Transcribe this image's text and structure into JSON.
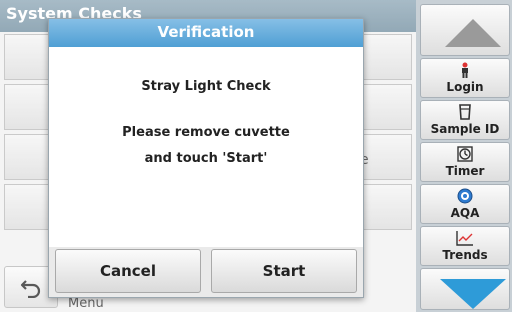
{
  "background": {
    "title": "System Checks",
    "right_fragment": "e",
    "bottom_fragment": "Menu"
  },
  "sidebar": {
    "items": [
      {
        "label": "Login",
        "icon": "person-icon"
      },
      {
        "label": "Sample ID",
        "icon": "cup-icon"
      },
      {
        "label": "Timer",
        "icon": "timer-icon"
      },
      {
        "label": "AQA",
        "icon": "target-icon"
      },
      {
        "label": "Trends",
        "icon": "trend-chart-icon"
      }
    ]
  },
  "dialog": {
    "title": "Verification",
    "heading": "Stray Light Check",
    "message_line1": "Please remove cuvette",
    "message_line2": "and touch 'Start'",
    "cancel_label": "Cancel",
    "start_label": "Start"
  },
  "colors": {
    "accent_blue": "#2e9bd8",
    "header_blue": "#4f9fd4"
  }
}
